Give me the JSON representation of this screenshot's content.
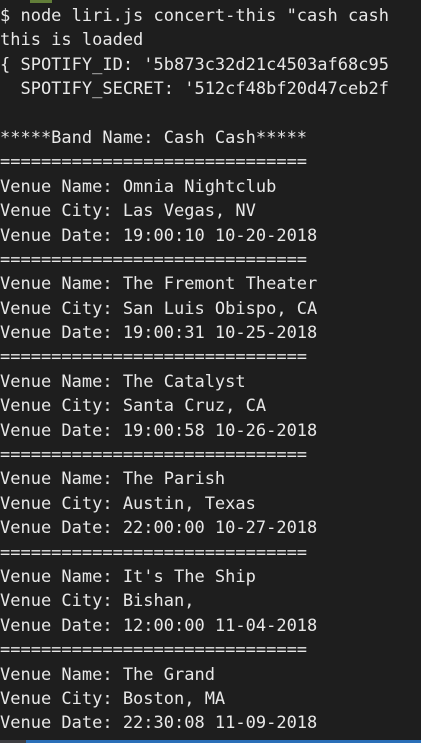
{
  "terminal": {
    "command_line": "$ node liri.js concert-this \"cash cash",
    "status_line": "this is loaded",
    "spotify_id_line": "{ SPOTIFY_ID: '5b873c32d21c4503af68c95",
    "spotify_secret_line": "  SPOTIFY_SECRET: '512cf48bf20d47ceb2f",
    "band_line": "*****Band Name: Cash Cash*****",
    "separator": "==============================",
    "venues": [
      {
        "name": "Venue Name: Omnia Nightclub",
        "city": "Venue City: Las Vegas, NV",
        "date": "Venue Date: 19:00:10 10-20-2018"
      },
      {
        "name": "Venue Name: The Fremont Theater",
        "city": "Venue City: San Luis Obispo, CA",
        "date": "Venue Date: 19:00:31 10-25-2018"
      },
      {
        "name": "Venue Name: The Catalyst",
        "city": "Venue City: Santa Cruz, CA",
        "date": "Venue Date: 19:00:58 10-26-2018"
      },
      {
        "name": "Venue Name: The Parish",
        "city": "Venue City: Austin, Texas",
        "date": "Venue Date: 22:00:00 10-27-2018"
      },
      {
        "name": "Venue Name: It's The Ship",
        "city": "Venue City: Bishan,",
        "date": "Venue Date: 12:00:00 11-04-2018"
      },
      {
        "name": "Venue Name: The Grand",
        "city": "Venue City: Boston, MA",
        "date": "Venue Date: 22:30:08 11-09-2018"
      }
    ]
  }
}
